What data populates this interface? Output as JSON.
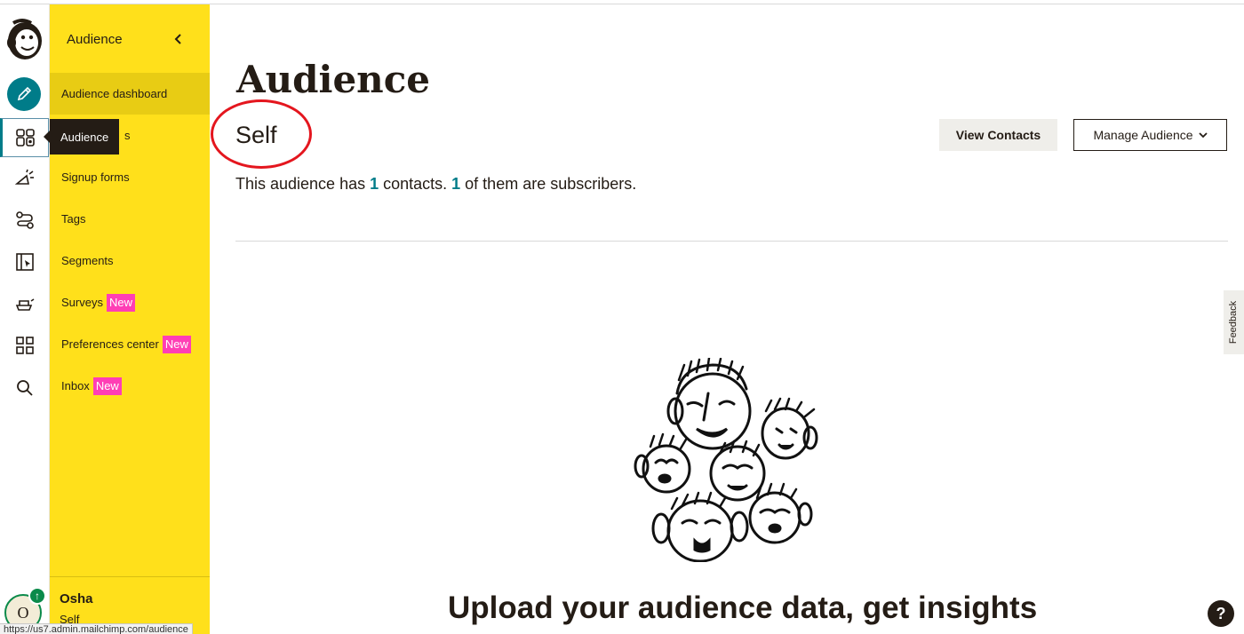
{
  "rail": {
    "items": [
      {
        "name": "create",
        "tooltip": ""
      },
      {
        "name": "audience",
        "tooltip": "Audience"
      },
      {
        "name": "campaigns"
      },
      {
        "name": "automations"
      },
      {
        "name": "website"
      },
      {
        "name": "content"
      },
      {
        "name": "integrations"
      },
      {
        "name": "search"
      }
    ],
    "active": "audience",
    "tooltip_label": "Audience",
    "avatar_initial": "O",
    "avatar_badge": "↑",
    "accent_color": "#007c89"
  },
  "sidebar": {
    "header": "Audience",
    "items": [
      {
        "label": "Audience dashboard",
        "active": true
      },
      {
        "label": "s"
      },
      {
        "label": "Signup forms"
      },
      {
        "label": "Tags"
      },
      {
        "label": "Segments"
      },
      {
        "label": "Surveys",
        "badge": "New"
      },
      {
        "label": "Preferences center",
        "badge": "New"
      },
      {
        "label": "Inbox",
        "badge": "New"
      }
    ],
    "user_name": "Osha",
    "org_name": "Self",
    "background_color": "#ffe01b",
    "badge_color": "#ff3eb5"
  },
  "main": {
    "title": "Audience",
    "audience_name": "Self",
    "summary": {
      "prefix": "This audience has ",
      "contacts": "1",
      "middle": " contacts. ",
      "subscribers": "1",
      "suffix": " of them are subscribers."
    },
    "view_contacts_label": "View Contacts",
    "manage_audience_label": "Manage Audience",
    "cta_heading": "Upload your audience data, get insights",
    "annotation_color": "#e4161e"
  },
  "feedback_label": "Feedback",
  "help_label": "?",
  "status_url": "https://us7.admin.mailchimp.com/audience"
}
